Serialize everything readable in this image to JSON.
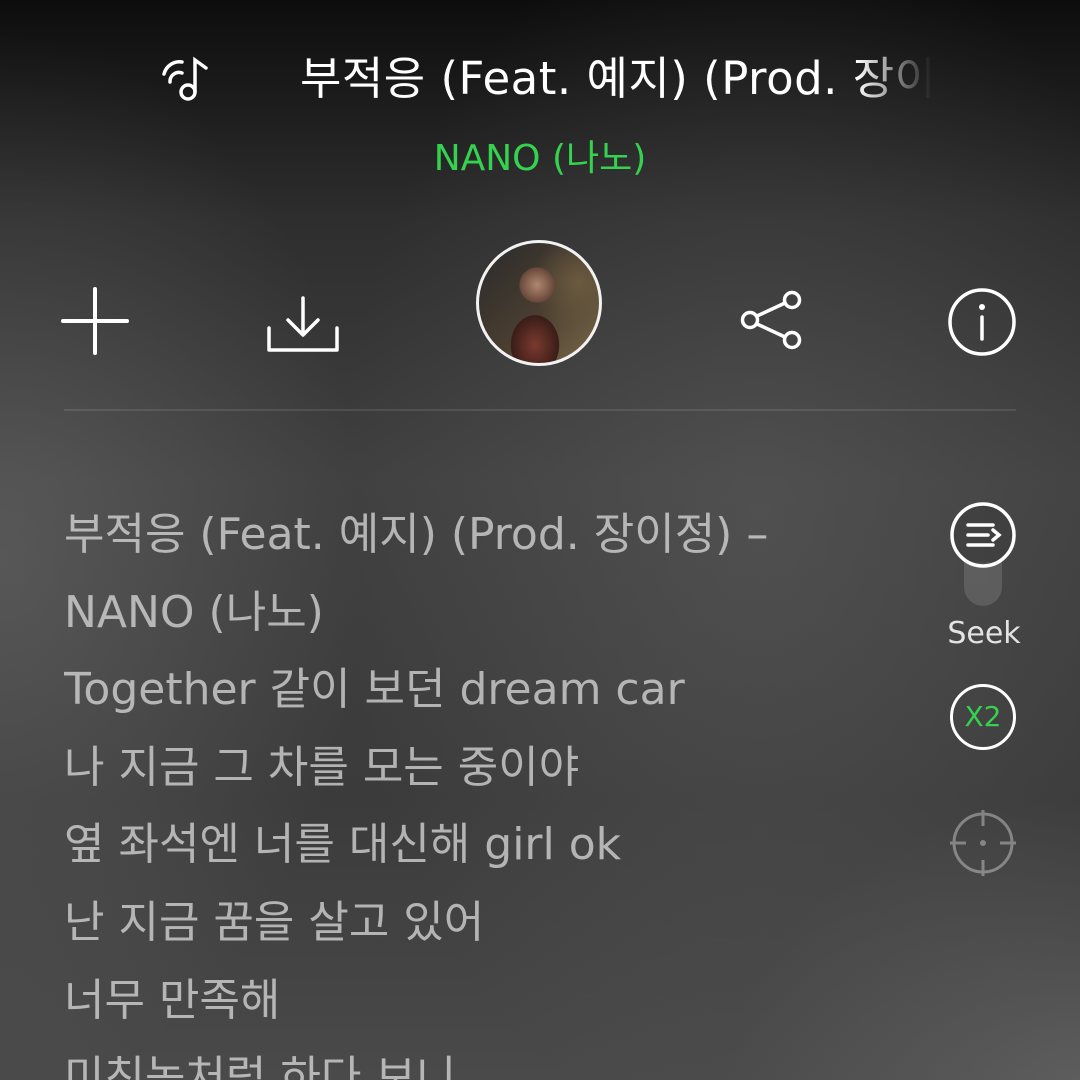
{
  "header": {
    "title": "부적응 (Feat. 예지) (Prod. 장이정)",
    "artist": "NANO (나노)",
    "icon": "music-note-icon"
  },
  "actions": {
    "icons": [
      "plus-icon",
      "download-icon",
      "album-art",
      "share-icon",
      "info-icon"
    ]
  },
  "lyrics": {
    "lines": [
      "부적응 (Feat. 예지) (Prod. 장이정) –",
      "NANO (나노)",
      "Together 같이 보던 dream car",
      "나 지금 그 차를 모는 중이야",
      "옆 좌석엔 너를 대신해 girl ok",
      "난 지금 꿈을 살고 있어",
      "너무 만족해",
      "미친놈처럼 하다 보니"
    ]
  },
  "controls": {
    "seek_label": "Seek",
    "speed_label": "X2",
    "accent_color": "#35d24f",
    "icons": [
      "lyric-mode-icon",
      "seek-slider",
      "speed-icon",
      "focus-icon"
    ]
  }
}
